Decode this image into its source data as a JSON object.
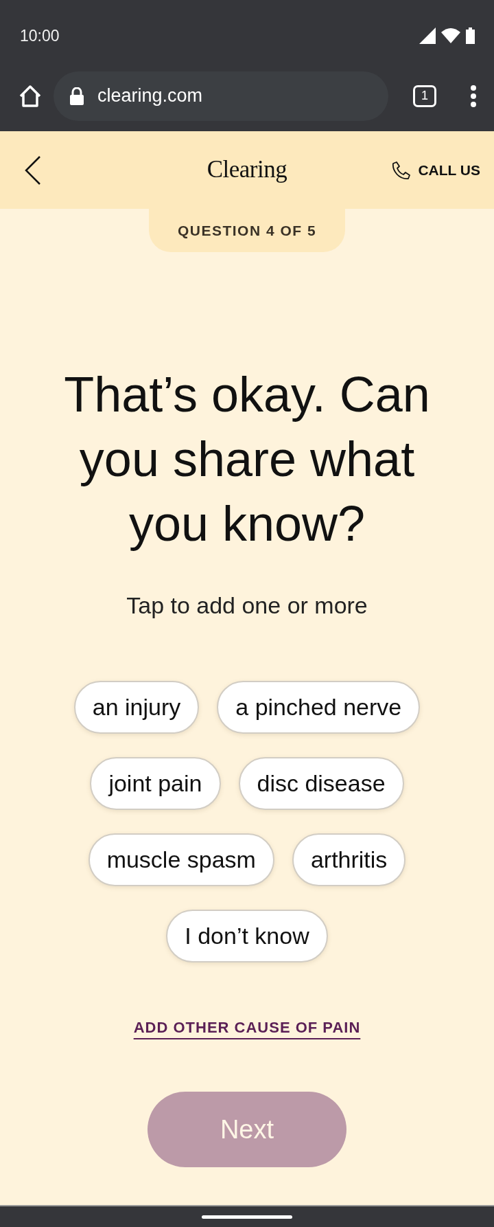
{
  "status_bar": {
    "time": "10:00"
  },
  "browser": {
    "url": "clearing.com",
    "tab_count": "1"
  },
  "header": {
    "brand": "Clearing",
    "call_label": "CALL US"
  },
  "progress": {
    "label": "QUESTION 4 OF 5"
  },
  "question": {
    "title": "That’s okay. Can you share what you know?",
    "subtitle": "Tap to add one or more"
  },
  "options": [
    {
      "label": "an injury",
      "selected": false
    },
    {
      "label": "a pinched nerve",
      "selected": false
    },
    {
      "label": "joint pain",
      "selected": false
    },
    {
      "label": "disc disease",
      "selected": false
    },
    {
      "label": "muscle spasm",
      "selected": false
    },
    {
      "label": "arthritis",
      "selected": false
    },
    {
      "label": "I don’t know",
      "selected": false
    }
  ],
  "add_other_link": "ADD OTHER CAUSE OF PAIN",
  "next_button": {
    "label": "Next",
    "disabled": true
  }
}
